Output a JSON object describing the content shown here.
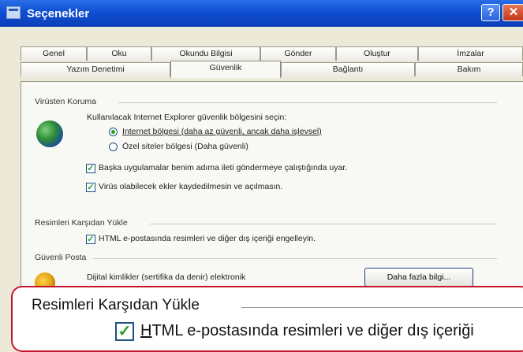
{
  "window": {
    "title": "Seçenekler",
    "help_label": "?",
    "close_label": "✕"
  },
  "tabs": {
    "row1": [
      "Genel",
      "Oku",
      "Okundu Bilgisi",
      "Gönder",
      "Oluştur",
      "İmzalar"
    ],
    "row2": [
      "Yazım Denetimi",
      "Güvenlik",
      "Bağlantı",
      "Bakım"
    ],
    "active": "Güvenlik"
  },
  "virus": {
    "heading": "Virüsten Koruma",
    "zone_prompt": "Kullanılacak Internet Explorer güvenlik bölgesini seçin:",
    "radio_internet": "Internet bölgesi (daha az güvenli, ancak daha işlevsel)",
    "radio_restricted": "Özel siteler bölgesi (Daha güvenli)",
    "selected_zone": "internet",
    "check_warn": "Başka uygulamalar benim adıma ileti göndermeye çalıştığında uyar.",
    "check_warn_checked": true,
    "check_attach": "Virüs olabilecek ekler kaydedilmesin ve açılmasın.",
    "check_attach_checked": true
  },
  "images": {
    "heading": "Resimleri Karşıdan Yükle",
    "check_block": "HTML e-postasında resimleri ve diğer dış içeriği engelleyin.",
    "check_block_checked": true
  },
  "secure_mail": {
    "heading": "Güvenli Posta",
    "desc": "Dijital kimlikler (sertifika da denir) elektronik",
    "more_button": "Daha fazla bilgi..."
  },
  "zoom": {
    "heading": "Resimleri Karşıdan Yükle",
    "check_text_rest": "TML e-postasında resimleri ve diğer dış içeriği",
    "check_text_first": "H",
    "checked": true
  },
  "icons": {
    "globe": "globe-icon",
    "shield": "security-badge-icon",
    "check": "check-icon"
  },
  "colors": {
    "titlebar": "#0f4fd2",
    "callout_border": "#c4172d",
    "check": "#21a121"
  }
}
